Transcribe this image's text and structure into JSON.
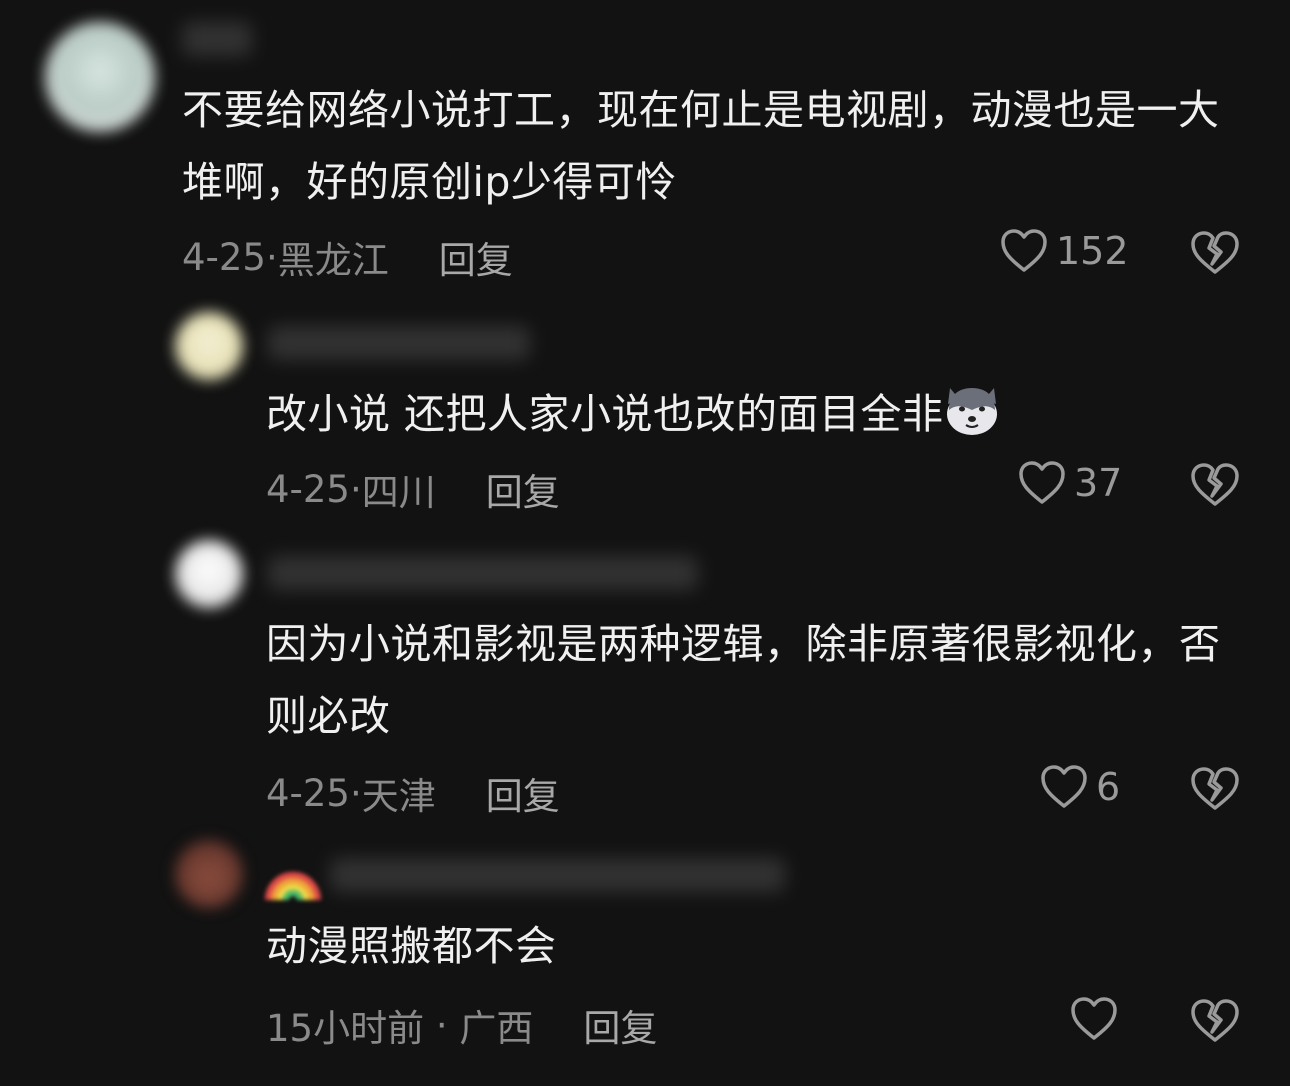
{
  "comments": [
    {
      "text": "不要给网络小说打工，现在何止是电视剧，动漫也是一大堆啊，好的原创ip少得可怜",
      "date": "4-25",
      "location": "黑龙江",
      "reply_label": "回复",
      "likes": "152"
    },
    {
      "text": "改小说 还把人家小说也改的面目全非",
      "emoji": "husky-emoji",
      "date": "4-25",
      "location": "四川",
      "reply_label": "回复",
      "likes": "37"
    },
    {
      "text": "因为小说和影视是两种逻辑，除非原著很影视化，否则必改",
      "date": "4-25",
      "location": "天津",
      "reply_label": "回复",
      "likes": "6"
    },
    {
      "text": "动漫照搬都不会",
      "date": "15小时前",
      "location": "广西",
      "reply_label": "回复",
      "likes": ""
    }
  ],
  "colors": {
    "background": "#121212",
    "text": "#f0f0f0",
    "meta": "#8a8a8a"
  },
  "icons": [
    "heart-outline-icon",
    "broken-heart-icon",
    "rainbow-emoji"
  ]
}
